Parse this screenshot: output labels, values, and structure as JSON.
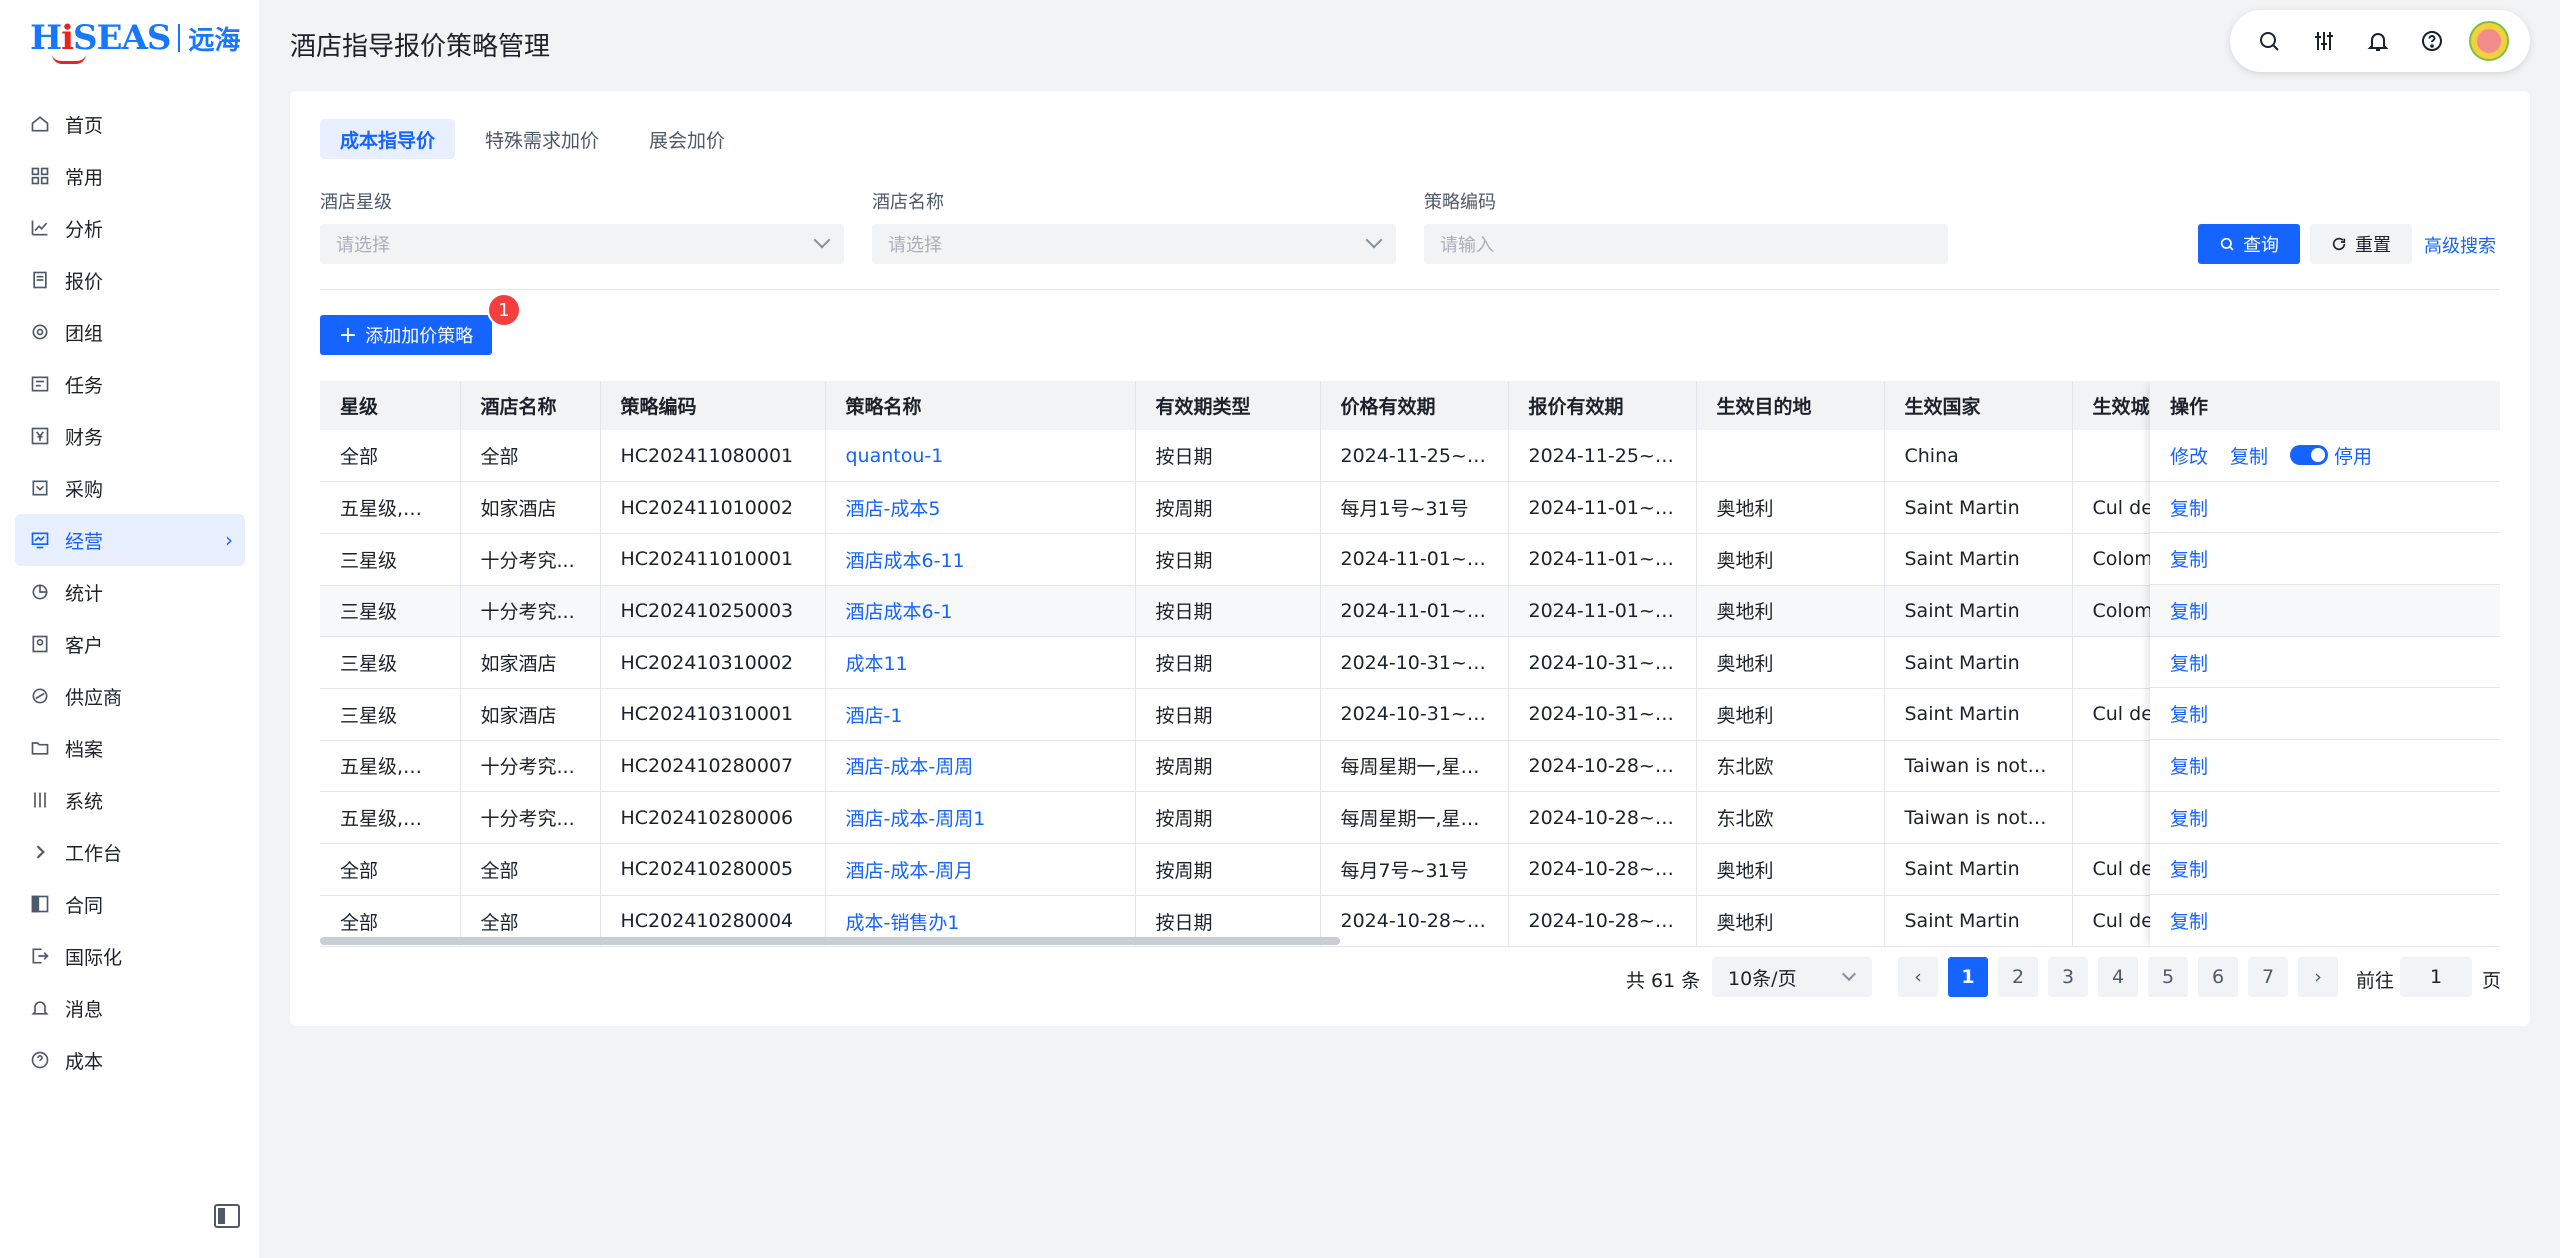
{
  "app": {
    "logo_text": "HiSEAS",
    "logo_cn": "远海",
    "page_title": "酒店指导报价策略管理"
  },
  "sidebar": {
    "items": [
      {
        "label": "首页",
        "icon": "home-icon"
      },
      {
        "label": "常用",
        "icon": "grid-icon"
      },
      {
        "label": "分析",
        "icon": "chart-line-icon"
      },
      {
        "label": "报价",
        "icon": "document-icon"
      },
      {
        "label": "团组",
        "icon": "group-icon"
      },
      {
        "label": "任务",
        "icon": "task-icon"
      },
      {
        "label": "财务",
        "icon": "yen-icon"
      },
      {
        "label": "采购",
        "icon": "cart-icon"
      },
      {
        "label": "经营",
        "icon": "business-icon",
        "active": true
      },
      {
        "label": "统计",
        "icon": "pie-icon"
      },
      {
        "label": "客户",
        "icon": "customer-icon"
      },
      {
        "label": "供应商",
        "icon": "supplier-icon"
      },
      {
        "label": "档案",
        "icon": "folder-icon"
      },
      {
        "label": "系统",
        "icon": "sliders-icon"
      },
      {
        "label": "工作台",
        "icon": "chevron-right-icon"
      },
      {
        "label": "合同",
        "icon": "contract-icon"
      },
      {
        "label": "国际化",
        "icon": "export-icon"
      },
      {
        "label": "消息",
        "icon": "bell-icon"
      },
      {
        "label": "成本",
        "icon": "help-icon"
      }
    ]
  },
  "tabs": [
    {
      "label": "成本指导价",
      "active": true
    },
    {
      "label": "特殊需求加价"
    },
    {
      "label": "展会加价"
    }
  ],
  "filters": {
    "star": {
      "label": "酒店星级",
      "placeholder": "请选择"
    },
    "hotel": {
      "label": "酒店名称",
      "placeholder": "请选择"
    },
    "code": {
      "label": "策略编码",
      "placeholder": "请输入"
    },
    "query_label": "查询",
    "reset_label": "重置",
    "advanced_label": "高级搜索"
  },
  "add_button_label": "添加加价策略",
  "badge_count": "1",
  "table": {
    "columns": [
      "星级",
      "酒店名称",
      "策略编码",
      "策略名称",
      "有效期类型",
      "价格有效期",
      "报价有效期",
      "生效目的地",
      "生效国家",
      "生效城市"
    ],
    "ops_header": "操作",
    "rows": [
      [
        "全部",
        "全部",
        "HC202411080001",
        "quantou-1",
        "按日期",
        "2024-11-25~20...",
        "2024-11-25~20...",
        "",
        "China",
        ""
      ],
      [
        "五星级,三...",
        "如家酒店",
        "HC202411010002",
        "酒店-成本5",
        "按周期",
        "每月1号~31号",
        "2024-11-01~20...",
        "奥地利",
        "Saint Martin",
        "Cul de"
      ],
      [
        "三星级",
        "十分考究...",
        "HC202411010001",
        "酒店成本6-11",
        "按日期",
        "2024-11-01~20...",
        "2024-11-01~20...",
        "奥地利",
        "Saint Martin",
        "Colomb"
      ],
      [
        "三星级",
        "十分考究...",
        "HC202410250003",
        "酒店成本6-1",
        "按日期",
        "2024-11-01~20...",
        "2024-11-01~20...",
        "奥地利",
        "Saint Martin",
        "Colomb"
      ],
      [
        "三星级",
        "如家酒店",
        "HC202410310002",
        "成本11",
        "按日期",
        "2024-10-31~20...",
        "2024-10-31~20...",
        "奥地利",
        "Saint Martin",
        ""
      ],
      [
        "三星级",
        "如家酒店",
        "HC202410310001",
        "酒店-1",
        "按日期",
        "2024-10-31~20...",
        "2024-10-31~20...",
        "奥地利",
        "Saint Martin",
        "Cul de"
      ],
      [
        "五星级,三...",
        "十分考究...",
        "HC202410280007",
        "酒店-成本-周周",
        "按周期",
        "每周星期一,星期...",
        "2024-10-28~20...",
        "东北欧",
        "Taiwan is not a ...",
        ""
      ],
      [
        "五星级,三...",
        "十分考究...",
        "HC202410280006",
        "酒店-成本-周周1",
        "按周期",
        "每周星期一,星期...",
        "2024-10-28~20...",
        "东北欧",
        "Taiwan is not a ...",
        ""
      ],
      [
        "全部",
        "全部",
        "HC202410280005",
        "酒店-成本-周月",
        "按周期",
        "每月7号~31号",
        "2024-10-28~20...",
        "奥地利",
        "Saint Martin",
        "Cul de"
      ],
      [
        "全部",
        "全部",
        "HC202410280004",
        "成本-销售办1",
        "按日期",
        "2024-10-28~20...",
        "2024-10-28~20...",
        "奥地利",
        "Saint Martin",
        "Cul de"
      ]
    ],
    "ops": {
      "edit": "修改",
      "copy": "复制",
      "disable": "停用"
    }
  },
  "pagination": {
    "total_text": "共 61 条",
    "page_size": "10条/页",
    "pages": [
      "1",
      "2",
      "3",
      "4",
      "5",
      "6",
      "7"
    ],
    "current": "1",
    "goto_label": "前往",
    "goto_value": "1",
    "goto_suffix": "页",
    "prev": "‹",
    "next": "›"
  },
  "colors": {
    "primary": "#1664ff",
    "danger": "#f53f3f"
  }
}
